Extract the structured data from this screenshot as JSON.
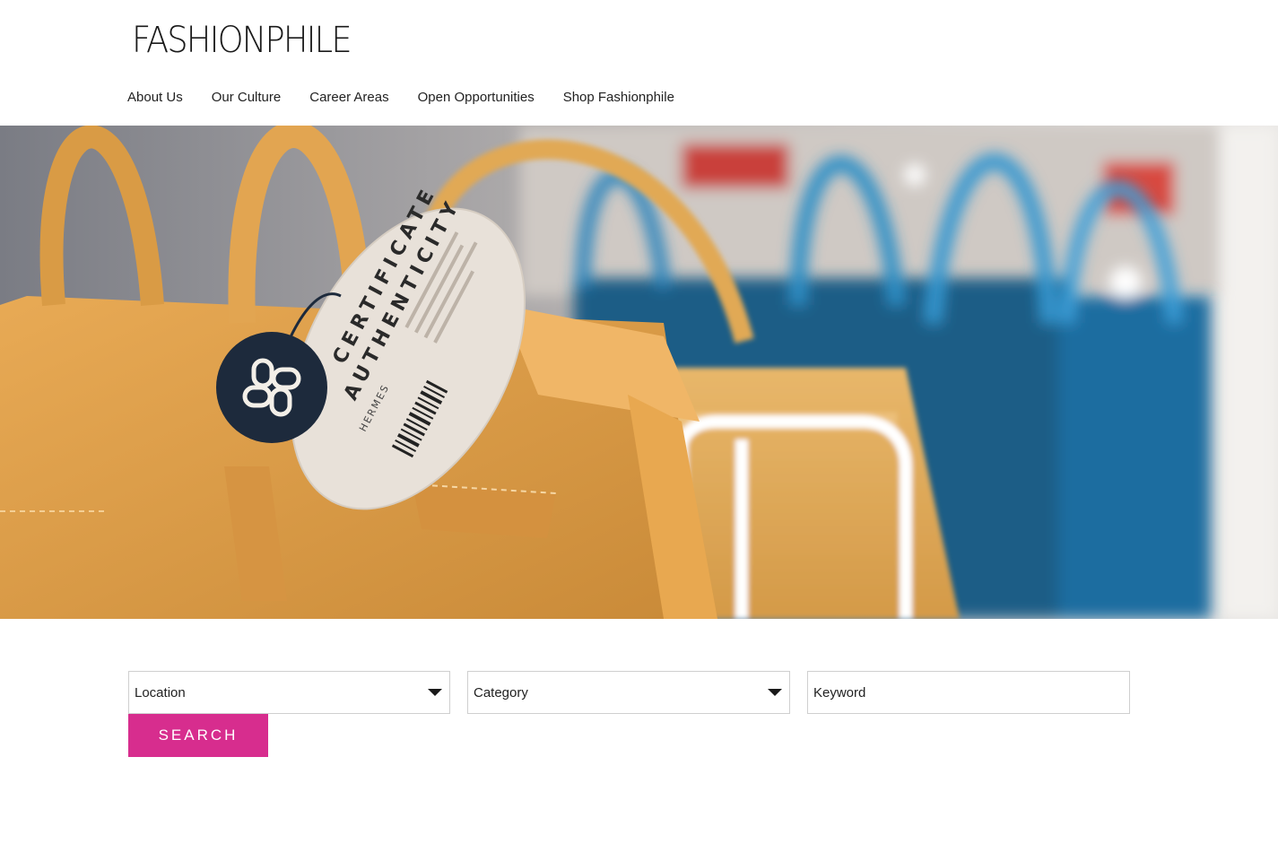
{
  "brand": {
    "logo_text": "FASHIONPHILE",
    "accent_color": "#d72d8e"
  },
  "nav": {
    "items": [
      {
        "label": "About Us"
      },
      {
        "label": "Our Culture"
      },
      {
        "label": "Career Areas"
      },
      {
        "label": "Open Opportunities"
      },
      {
        "label": "Shop Fashionphile"
      }
    ]
  },
  "hero": {
    "tag_title_line1": "CERTIFICATE",
    "tag_title_line2": "AUTHENTICITY",
    "tag_brand": "HERMES"
  },
  "search": {
    "location_value": "Location",
    "category_value": "Category",
    "keyword_placeholder": "Keyword",
    "button_label": "SEARCH",
    "icon": "chevron-down-icon"
  }
}
